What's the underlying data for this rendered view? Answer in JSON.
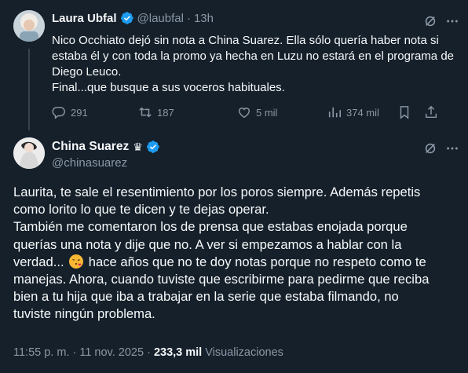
{
  "colors": {
    "bg": "#15202b",
    "text": "#f7f9f9",
    "muted": "#8b98a5",
    "accent": "#1d9bf0",
    "line": "#38444d"
  },
  "quoted_tweet": {
    "author_name": "Laura Ubfal",
    "author_handle": "@laubfal",
    "separator": "·",
    "time": "13h",
    "lines": [
      "Nico Occhiato dejó sin nota a China Suarez. Ella sólo quería haber nota si",
      "estaba él y con toda la promo ya hecha en Luzu no estará en el programa de",
      "Diego Leuco.",
      "Final...que busque a sus voceros habituales."
    ],
    "replies": "291",
    "retweets": "187",
    "likes": "5 mil",
    "views": "374 mil",
    "icons": [
      "grok-icon",
      "more-icon",
      "reply-icon",
      "retweet-icon",
      "like-icon",
      "views-icon",
      "bookmark-icon",
      "share-icon"
    ]
  },
  "main_tweet": {
    "author_name": "China Suarez",
    "crown": "♛",
    "author_handle": "@chinasuarez",
    "lines_before_emoji": [
      "Laurita, te sale el resentimiento por los poros siempre. Además repetis",
      "como lorito lo que te dicen y te dejas operar.",
      "También me comentaron los de prensa que estabas enojada porque",
      "querías una nota y dije que no. A ver si empezamos a hablar con la"
    ],
    "emoji_line_start": "verdad... ",
    "emoji_line_end": " hace años que no te doy notas porque no respeto como te",
    "lines_after_emoji": [
      "manejas. Ahora, cuando tuviste que escribirme para pedirme que reciba",
      "bien a tu hija que iba a trabajar en la serie que estaba filmando, no",
      "tuviste ningún problema."
    ],
    "emoji": "face-blowing-kiss",
    "timestamp": "11:55 p. m. · 11 nov. 2025 · ",
    "views_count": "233,3 mil",
    "views_label": " Visualizaciones"
  }
}
